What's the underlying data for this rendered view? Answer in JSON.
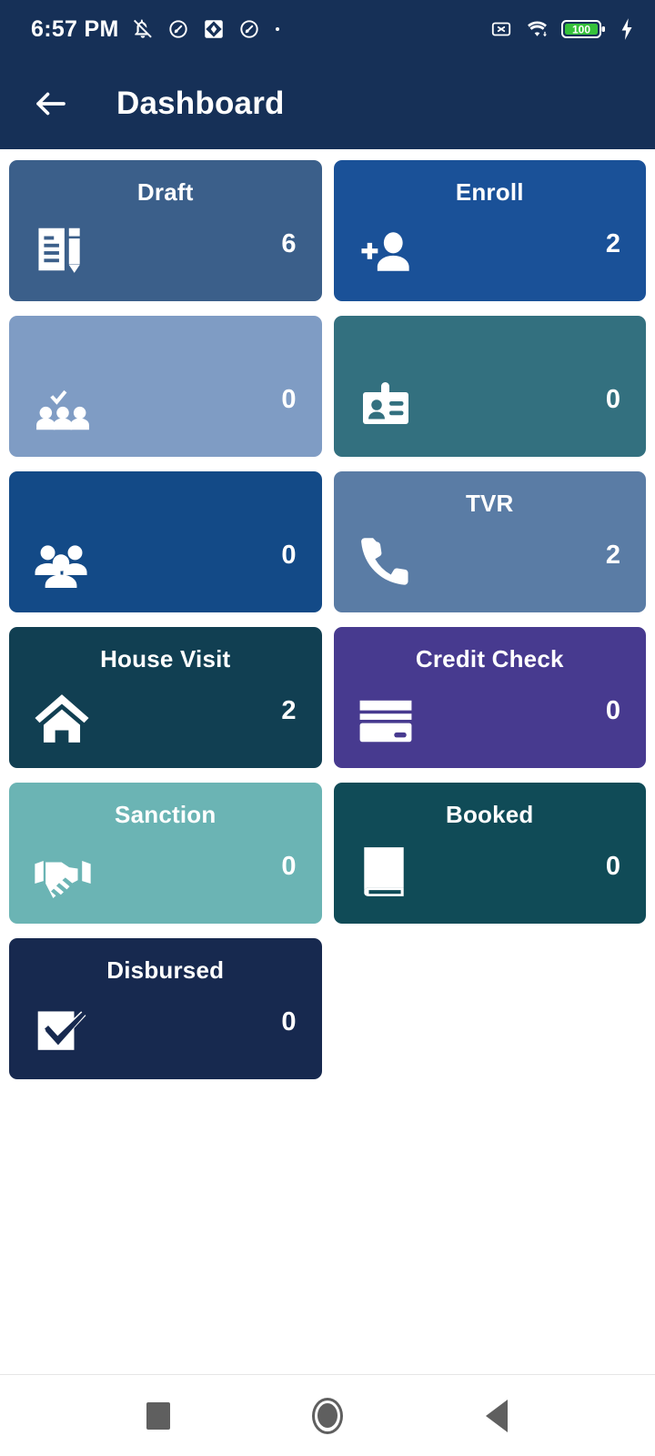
{
  "status_bar": {
    "time": "6:57 PM",
    "battery_level": "100",
    "left_icons": [
      "bell-off-icon",
      "app-circle-icon",
      "app-diamond-icon",
      "app-circle-2-icon",
      "dot-icon"
    ],
    "right_icons": [
      "no-sim-icon",
      "wifi-icon",
      "battery-icon",
      "charging-bolt-icon"
    ]
  },
  "app_bar": {
    "back_label": "",
    "title": "Dashboard"
  },
  "theme": {
    "header_bg": "#163057",
    "page_bg": "#ffffff",
    "battery_green": "#35c13a",
    "nav_icon": "#5f5f5f"
  },
  "cards": [
    {
      "label": "Draft",
      "count": "6",
      "color": "#3b5f8a",
      "icon": "document-pencil-icon"
    },
    {
      "label": "Enroll",
      "count": "2",
      "color": "#1a5198",
      "icon": "person-add-icon"
    },
    {
      "label": "",
      "count": "0",
      "color": "#7f9cc4",
      "icon": "group-check-icon"
    },
    {
      "label": "",
      "count": "0",
      "color": "#33707f",
      "icon": "id-badge-icon"
    },
    {
      "label": "",
      "count": "0",
      "color": "#134a87",
      "icon": "people-group-icon"
    },
    {
      "label": "TVR",
      "count": "2",
      "color": "#5a7ca5",
      "icon": "phone-icon"
    },
    {
      "label": "House Visit",
      "count": "2",
      "color": "#113f52",
      "icon": "home-icon"
    },
    {
      "label": "Credit Check",
      "count": "0",
      "color": "#473a8f",
      "icon": "credit-card-icon"
    },
    {
      "label": "Sanction",
      "count": "0",
      "color": "#6bb4b4",
      "icon": "handshake-icon"
    },
    {
      "label": "Booked",
      "count": "0",
      "color": "#104b57",
      "icon": "book-icon"
    },
    {
      "label": "Disbursed",
      "count": "0",
      "color": "#17294f",
      "icon": "checkbox-check-icon"
    }
  ],
  "nav_bar": {
    "recents_label": "",
    "home_label": "",
    "back_label": ""
  }
}
